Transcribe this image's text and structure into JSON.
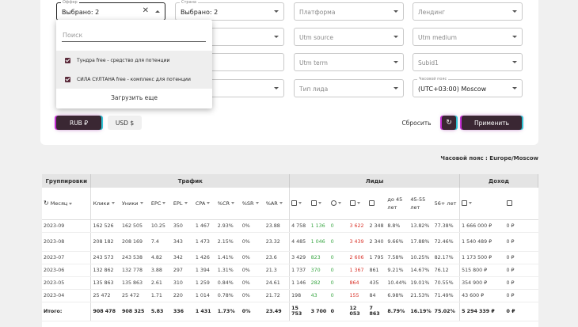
{
  "filters": {
    "offer": {
      "label": "Оффер",
      "value": "Выбрано: 2"
    },
    "country": {
      "label": "Страна",
      "value": "Выбрано: 2"
    },
    "platform": {
      "placeholder": "Платформа"
    },
    "landing": {
      "placeholder": "Лендинг"
    },
    "utm_source": {
      "placeholder": "Utm source"
    },
    "utm_medium": {
      "placeholder": "Utm medium"
    },
    "utm_term": {
      "placeholder": "Utm term"
    },
    "subid1": {
      "placeholder": "Subid1"
    },
    "lead_type": {
      "placeholder": "Тип лида"
    },
    "timezone": {
      "label": "Часовой пояс",
      "value": "(UTC+03:00) Moscow"
    }
  },
  "dropdown": {
    "search_placeholder": "Поиск",
    "options": [
      {
        "label": "Тундра free - средство для потенции",
        "checked": true
      },
      {
        "label": "СИЛА СУЛТАНА free - комплекс для потенции",
        "checked": true
      }
    ],
    "load_more": "Загрузить еще"
  },
  "currency": {
    "rub": "RUB ₽",
    "usd": "USD $"
  },
  "actions": {
    "reset": "Сбросить",
    "apply": "Применить"
  },
  "timezone_note": "Часовой пояс : Europe/Moscow",
  "table": {
    "groups": [
      "Группировки",
      "Трафик",
      "Лиды",
      "Доход"
    ],
    "month_header": "Месяц",
    "traffic_cols": [
      "Клики",
      "Уники",
      "EPC",
      "EPL",
      "CPA",
      "%CR",
      "%SR",
      "%AR"
    ],
    "lead_pct_cols": [
      "до 45 лет",
      "45-55 лет",
      "56+ лет"
    ],
    "rows": [
      {
        "month": "2023-09",
        "clicks": "162 526",
        "uniq": "162 505",
        "epc": "10.25",
        "epl": "350",
        "cpa": "1 467",
        "cr": "2.93%",
        "sr": "0%",
        "ar": "23.88",
        "l1": "4 758",
        "l2": "1 136",
        "l3": "0",
        "l4": "3 622",
        "l5": "2 348",
        "p1": "8.8%",
        "p2": "13.82%",
        "p3": "77.38%",
        "inc": "1 666 000 ₽",
        "inc2": "0 ₽"
      },
      {
        "month": "2023-08",
        "clicks": "208 182",
        "uniq": "208 169",
        "epc": "7.4",
        "epl": "343",
        "cpa": "1 473",
        "cr": "2.15%",
        "sr": "0%",
        "ar": "23.32",
        "l1": "4 485",
        "l2": "1 046",
        "l3": "0",
        "l4": "3 439",
        "l5": "2 340",
        "p1": "9.66%",
        "p2": "17.88%",
        "p3": "72.46%",
        "inc": "1 540 489 ₽",
        "inc2": "0 ₽"
      },
      {
        "month": "2023-07",
        "clicks": "243 573",
        "uniq": "243 538",
        "epc": "4.82",
        "epl": "342",
        "cpa": "1 426",
        "cr": "1.41%",
        "sr": "0%",
        "ar": "23.6",
        "l1": "3 429",
        "l2": "823",
        "l3": "0",
        "l4": "2 606",
        "l5": "1 795",
        "p1": "7.58%",
        "p2": "10.25%",
        "p3": "82.17%",
        "inc": "1 173 500 ₽",
        "inc2": "0 ₽"
      },
      {
        "month": "2023-06",
        "clicks": "132 862",
        "uniq": "132 778",
        "epc": "3.88",
        "epl": "297",
        "cpa": "1 394",
        "cr": "1.31%",
        "sr": "0%",
        "ar": "21.3",
        "l1": "1 737",
        "l2": "370",
        "l3": "0",
        "l4": "1 367",
        "l5": "861",
        "p1": "9.21%",
        "p2": "14.67%",
        "p3": "76.12",
        "inc": "515 800 ₽",
        "inc2": "0 ₽"
      },
      {
        "month": "2023-05",
        "clicks": "135 863",
        "uniq": "135 863",
        "epc": "2.61",
        "epl": "310",
        "cpa": "1 259",
        "cr": "0.84%",
        "sr": "0%",
        "ar": "24.61",
        "l1": "1 146",
        "l2": "282",
        "l3": "0",
        "l4": "864",
        "l5": "435",
        "p1": "10.44%",
        "p2": "19.01%",
        "p3": "70.55%",
        "inc": "354 900 ₽",
        "inc2": "0 ₽"
      },
      {
        "month": "2023-04",
        "clicks": "25 472",
        "uniq": "25 472",
        "epc": "1.71",
        "epl": "220",
        "cpa": "1 014",
        "cr": "0.78%",
        "sr": "0%",
        "ar": "21.72",
        "l1": "198",
        "l2": "43",
        "l3": "0",
        "l4": "155",
        "l5": "84",
        "p1": "6.98%",
        "p2": "21.53%",
        "p3": "71.49%",
        "inc": "43 600 ₽",
        "inc2": "0 ₽"
      }
    ],
    "total": {
      "month": "Итого:",
      "clicks": "908 478",
      "uniq": "908 325",
      "epc": "5.83",
      "epl": "336",
      "cpa": "1 431",
      "cr": "1.73%",
      "sr": "0%",
      "ar": "23.49",
      "l1": "15 753",
      "l2": "3 700",
      "l3": "0",
      "l4": "12 053",
      "l5": "7 863",
      "p1": "8.79%",
      "p2": "16.19%",
      "p3": "75.02%",
      "inc": "5 294 339 ₽",
      "inc2": "0 ₽"
    }
  }
}
